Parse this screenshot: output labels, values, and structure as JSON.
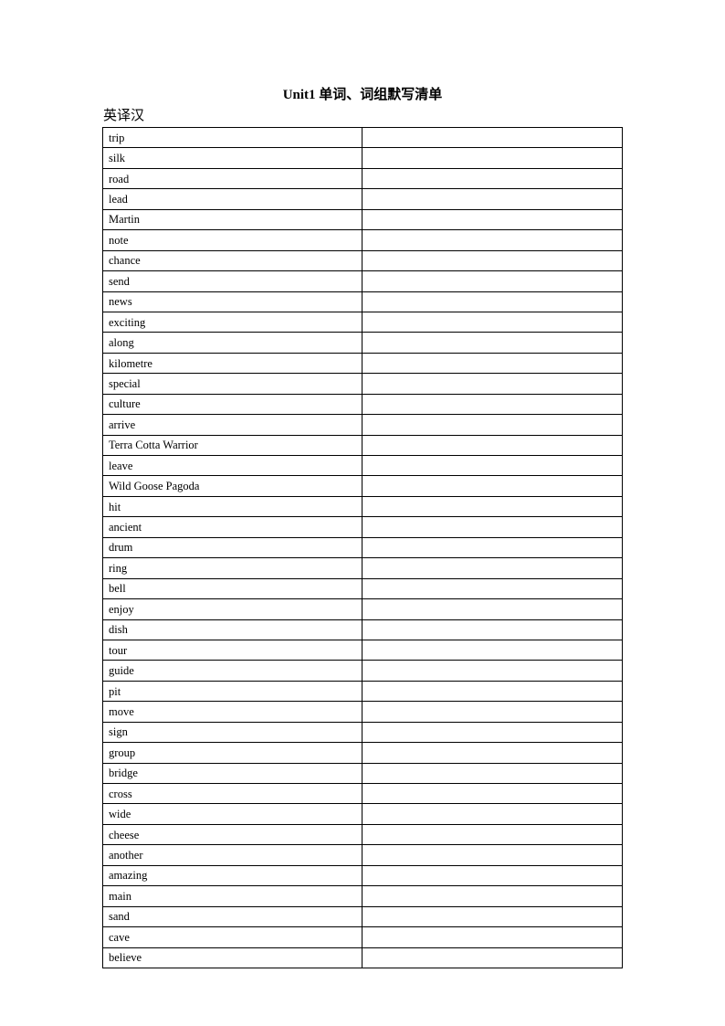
{
  "document": {
    "title": "Unit1 单词、词组默写清单",
    "section_label": "英译汉"
  },
  "table": {
    "columns": [
      "english_word",
      "chinese_answer_blank"
    ],
    "rows": [
      {
        "word": "trip",
        "answer": ""
      },
      {
        "word": "silk",
        "answer": ""
      },
      {
        "word": "road",
        "answer": ""
      },
      {
        "word": "lead",
        "answer": ""
      },
      {
        "word": "Martin",
        "answer": ""
      },
      {
        "word": "note",
        "answer": ""
      },
      {
        "word": "chance",
        "answer": ""
      },
      {
        "word": "send",
        "answer": ""
      },
      {
        "word": "news",
        "answer": ""
      },
      {
        "word": "exciting",
        "answer": ""
      },
      {
        "word": "along",
        "answer": ""
      },
      {
        "word": "kilometre",
        "answer": ""
      },
      {
        "word": "special",
        "answer": ""
      },
      {
        "word": "culture",
        "answer": ""
      },
      {
        "word": "arrive",
        "answer": ""
      },
      {
        "word": "Terra Cotta Warrior",
        "answer": ""
      },
      {
        "word": "leave",
        "answer": ""
      },
      {
        "word": "Wild Goose Pagoda",
        "answer": ""
      },
      {
        "word": "hit",
        "answer": ""
      },
      {
        "word": "ancient",
        "answer": ""
      },
      {
        "word": "drum",
        "answer": ""
      },
      {
        "word": "ring",
        "answer": ""
      },
      {
        "word": "bell",
        "answer": ""
      },
      {
        "word": "enjoy",
        "answer": ""
      },
      {
        "word": "dish",
        "answer": ""
      },
      {
        "word": "tour",
        "answer": ""
      },
      {
        "word": "guide",
        "answer": ""
      },
      {
        "word": "pit",
        "answer": ""
      },
      {
        "word": "move",
        "answer": ""
      },
      {
        "word": "sign",
        "answer": ""
      },
      {
        "word": "group",
        "answer": ""
      },
      {
        "word": "bridge",
        "answer": ""
      },
      {
        "word": "cross",
        "answer": ""
      },
      {
        "word": "wide",
        "answer": ""
      },
      {
        "word": "cheese",
        "answer": ""
      },
      {
        "word": "another",
        "answer": ""
      },
      {
        "word": "amazing",
        "answer": ""
      },
      {
        "word": "main",
        "answer": ""
      },
      {
        "word": "sand",
        "answer": ""
      },
      {
        "word": "cave",
        "answer": ""
      },
      {
        "word": "believe",
        "answer": ""
      }
    ]
  },
  "colors": {
    "page_background": "#ffffff",
    "text": "#000000",
    "table_border": "#000000"
  }
}
